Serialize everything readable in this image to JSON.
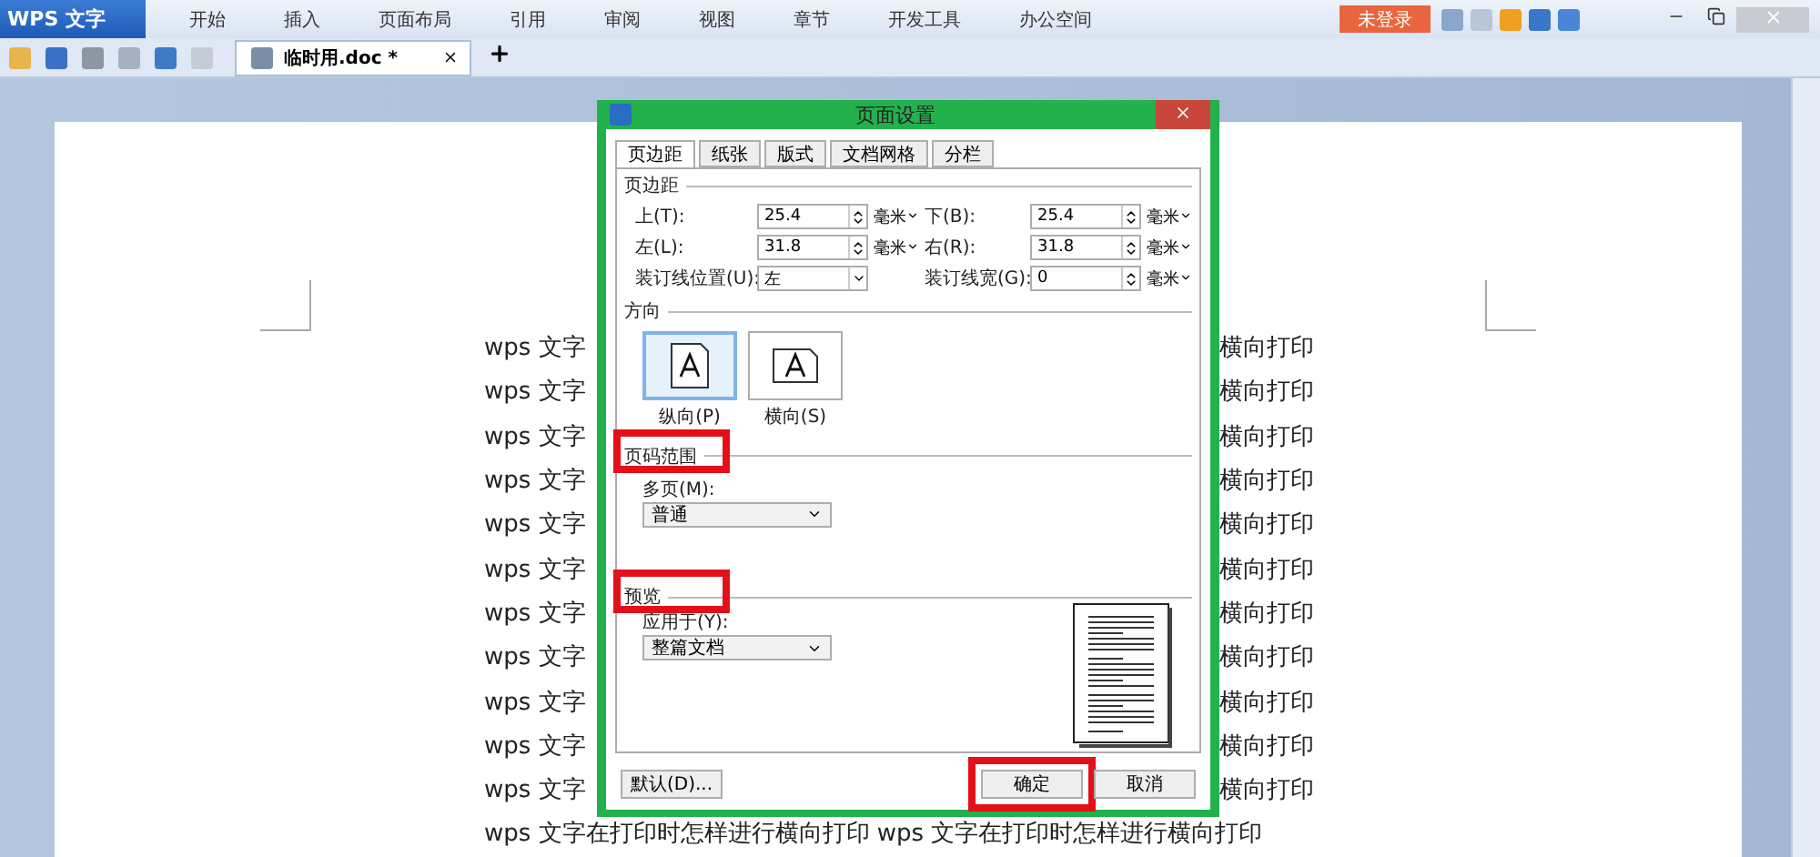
{
  "app": {
    "name": "WPS 文字",
    "login": "未登录"
  },
  "menu": [
    {
      "label": "开始"
    },
    {
      "label": "插入"
    },
    {
      "label": "页面布局"
    },
    {
      "label": "引用"
    },
    {
      "label": "审阅"
    },
    {
      "label": "视图"
    },
    {
      "label": "章节"
    },
    {
      "label": "开发工具"
    },
    {
      "label": "办公空间"
    }
  ],
  "doc_tabs": [
    {
      "label": "临时用.doc *",
      "selected": true
    }
  ],
  "document": {
    "lines": [
      {
        "kind": "split",
        "left": "wps 文字",
        "right": "横向打印"
      },
      {
        "kind": "split",
        "left": "wps 文字",
        "right": "横向打印"
      },
      {
        "kind": "split",
        "left": "wps 文字",
        "right": "横向打印"
      },
      {
        "kind": "split",
        "left": "wps 文字",
        "right": "横向打印"
      },
      {
        "kind": "split",
        "left": "wps 文字",
        "right": "横向打印"
      },
      {
        "kind": "split",
        "left": "wps 文字",
        "right": "横向打印"
      },
      {
        "kind": "split",
        "left": "wps 文字",
        "right": "横向打印"
      },
      {
        "kind": "split",
        "left": "wps 文字",
        "right": "横向打印"
      },
      {
        "kind": "split",
        "left": "wps 文字",
        "right": "横向打印"
      },
      {
        "kind": "split",
        "left": "wps 文字",
        "right": "横向打印"
      },
      {
        "kind": "split",
        "left": "wps 文字",
        "right": "横向打印"
      },
      {
        "kind": "full",
        "text": "wps 文字在打印时怎样进行横向打印 wps 文字在打印时怎样进行横向打印"
      }
    ]
  },
  "dialog": {
    "title": "页面设置",
    "tabs": [
      {
        "label": "页边距",
        "selected": true
      },
      {
        "label": "纸张",
        "selected": false
      },
      {
        "label": "版式",
        "selected": false
      },
      {
        "label": "文档网格",
        "selected": false
      },
      {
        "label": "分栏",
        "selected": false
      }
    ],
    "margins": {
      "title": "页边距",
      "rows": [
        [
          {
            "label": "上(T):",
            "value": "25.4",
            "unit": "毫米",
            "kind": "spin"
          },
          {
            "label": "下(B):",
            "value": "25.4",
            "unit": "毫米",
            "kind": "spin"
          }
        ],
        [
          {
            "label": "左(L):",
            "value": "31.8",
            "unit": "毫米",
            "kind": "spin"
          },
          {
            "label": "右(R):",
            "value": "31.8",
            "unit": "毫米",
            "kind": "spin"
          }
        ],
        [
          {
            "label": "装订线位置(U):",
            "value": "左",
            "kind": "select"
          },
          {
            "label": "装订线宽(G):",
            "value": "0",
            "unit": "毫米",
            "kind": "spin"
          }
        ]
      ]
    },
    "orientation": {
      "title": "方向",
      "options": [
        {
          "label": "纵向(P)",
          "selected": true
        },
        {
          "label": "横向(S)",
          "selected": false
        }
      ]
    },
    "page_range": {
      "title": "页码范围",
      "highlighted": true,
      "label": "多页(M):",
      "value": "普通"
    },
    "preview": {
      "title": "预览",
      "highlighted": true,
      "label": "应用于(Y):",
      "value": "整篇文档"
    },
    "buttons": [
      {
        "label": "默认(D)...",
        "kind": "default",
        "highlighted": false
      },
      {
        "label": "确定",
        "kind": "ok",
        "highlighted": true
      },
      {
        "label": "取消",
        "kind": "cancel",
        "highlighted": false
      }
    ]
  }
}
